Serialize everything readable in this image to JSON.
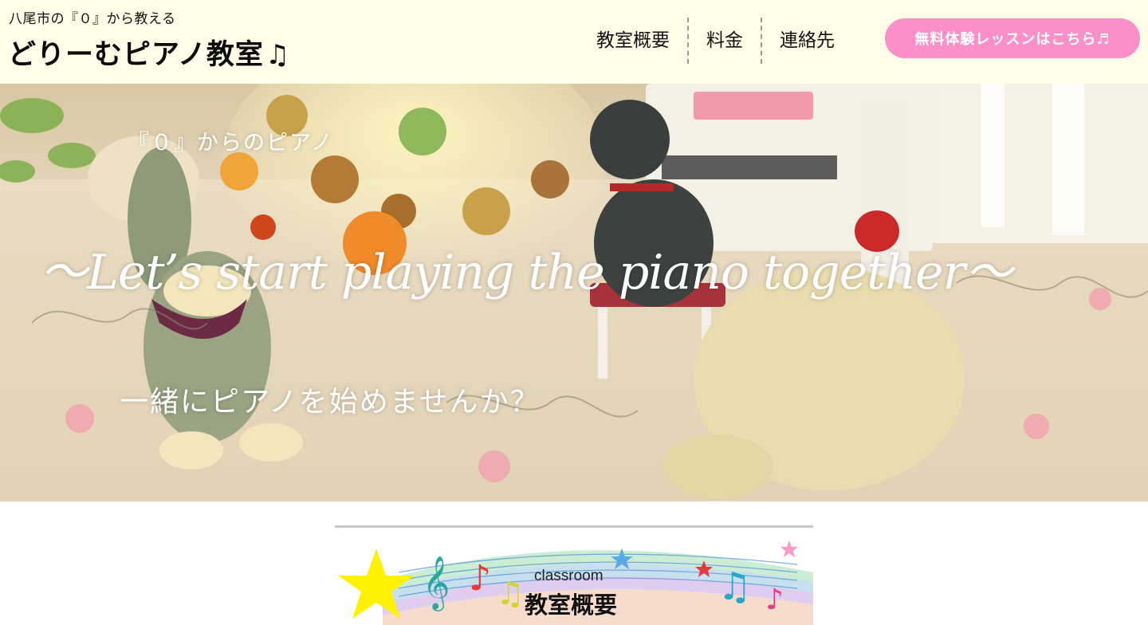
{
  "header": {
    "tagline": "八尾市の『０』から教える",
    "site_title": "どりーむピアノ教室",
    "site_title_icon": "music-note-icon",
    "nav": [
      {
        "label": "教室概要"
      },
      {
        "label": "料金"
      },
      {
        "label": "連絡先"
      }
    ],
    "cta_label": "無料体験レッスンはこちら♬",
    "colors": {
      "header_bg": "#fffde8",
      "cta_bg": "#fb8fc8"
    }
  },
  "hero": {
    "subtitle": "『０』からのピアノ",
    "english_tagline": "〜Let’s start playing the piano together〜",
    "japanese_tagline": "一緒にピアノを始めませんか？",
    "image": "photo of toy animal figurines with a miniature piano on an embroidered tablecloth"
  },
  "section": {
    "banner_en": "classroom",
    "banner_jp": "教室概要",
    "banner_image": "music staff rainbow with notes and stars"
  }
}
